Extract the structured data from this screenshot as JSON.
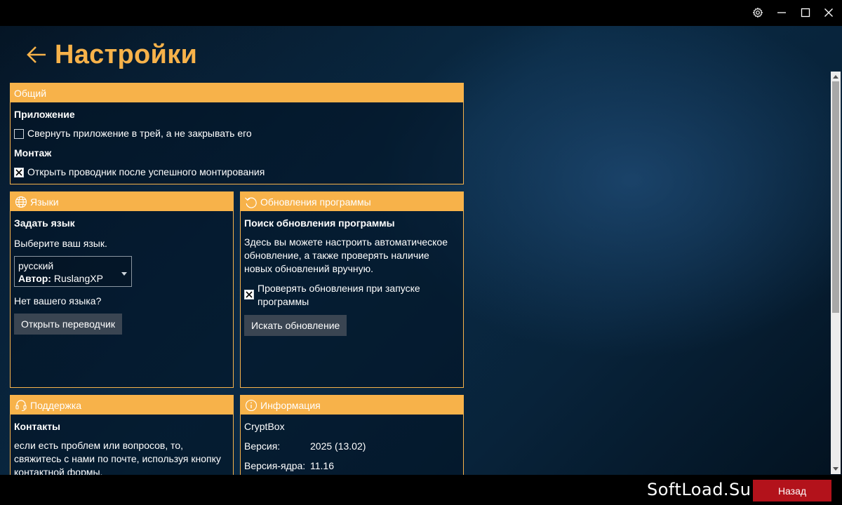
{
  "header": {
    "title": "Настройки"
  },
  "general": {
    "title": "Общий",
    "app_section": "Приложение",
    "minimize_tray": {
      "label": "Свернуть приложение в трей, а не закрывать его",
      "checked": false
    },
    "mount_section": "Монтаж",
    "open_explorer": {
      "label": "Открыть проводник после успешного монтирования",
      "checked": true
    }
  },
  "languages": {
    "title": "Языки",
    "section": "Задать язык",
    "prompt": "Выберите ваш язык.",
    "select_value": "русский",
    "author_label": "Автор:",
    "author_value": "RuslangXP",
    "missing_prompt": "Нет вашего языка?",
    "translator_button": "Открыть переводчик"
  },
  "updates": {
    "title": "Обновления программы",
    "section": "Поиск обновления программы",
    "description": "Здесь вы можете настроить автоматическое обновление, а также проверять наличие новых обновлений вручную.",
    "check_on_start": {
      "label": "Проверять обновления при запуске программы",
      "checked": true
    },
    "search_button": "Искать обновление"
  },
  "support": {
    "title": "Поддержка",
    "section": "Контакты",
    "description": "если есть проблем или вопросов, то, свяжитесь с нами по почте, используя кнопку контактной формы."
  },
  "info": {
    "title": "Информация",
    "product": "CryptBox",
    "version_label": "Версия:",
    "version_value": "2025 (13.02)",
    "core_label": "Версия-ядра:",
    "core_value": "11.16"
  },
  "footer": {
    "brand": "SoftLoad.Su",
    "back_button": "Назад"
  },
  "colors": {
    "accent": "#f7b24a",
    "back_button": "#b3121b",
    "button": "#3a4552"
  }
}
